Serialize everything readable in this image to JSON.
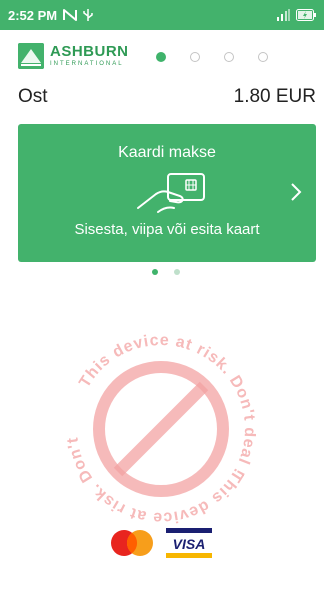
{
  "status_bar": {
    "time": "2:52 PM",
    "background_color": "#43b26c",
    "icons": [
      "nfc-icon",
      "usb-icon",
      "signal-icon",
      "battery-charging-icon"
    ]
  },
  "header": {
    "logo_title": "ASHBURN",
    "logo_subtitle": "INTERNATIONAL",
    "pager_total": 4,
    "pager_active_index": 0
  },
  "transaction": {
    "type_label": "Ost",
    "amount": "1.80 EUR"
  },
  "card_panel": {
    "title": "Kaardi makse",
    "subtitle": "Sisesta, viipa või esita kaart",
    "icon": "card-tap-icon",
    "chevron": "chevron-right-icon",
    "color": "#43b26c"
  },
  "carousel": {
    "total": 2,
    "active_index": 0
  },
  "watermark": {
    "text": "This device at risk. Don't deal !",
    "color": "#f08a8a"
  },
  "payment_brands": [
    "mastercard-icon",
    "VISA"
  ]
}
